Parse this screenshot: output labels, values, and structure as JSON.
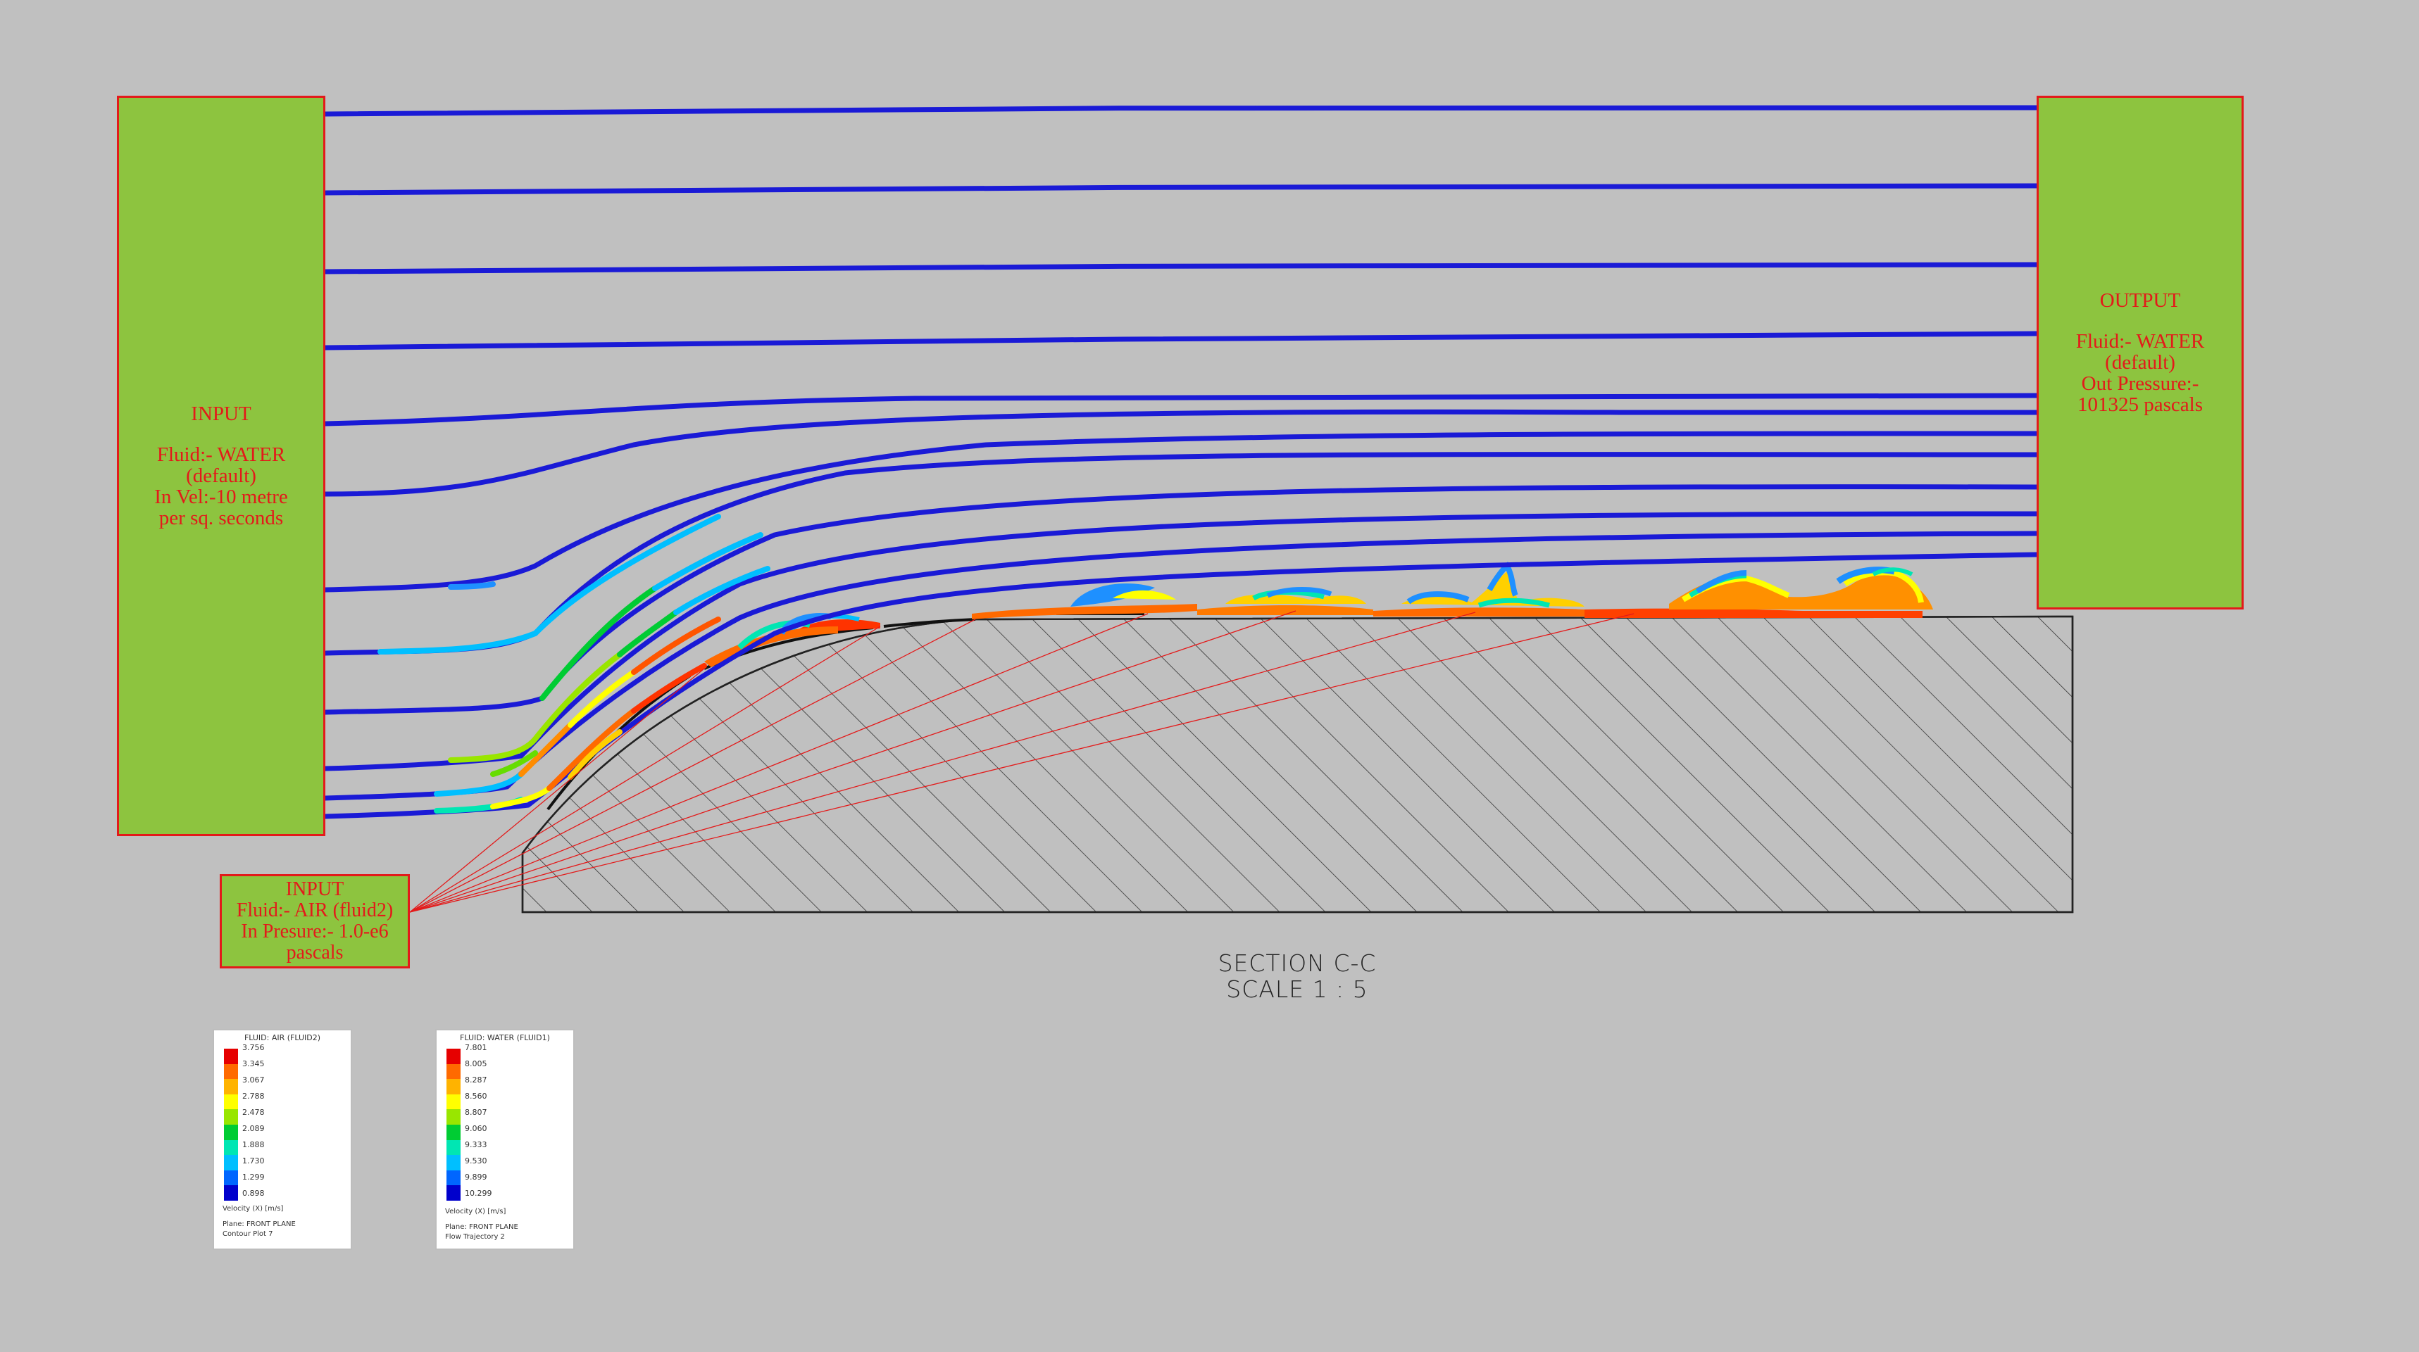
{
  "input_water": {
    "title": "INPUT",
    "lines": [
      "Fluid:- WATER",
      "(default)",
      "In Vel:-10 metre",
      "per sq. seconds"
    ]
  },
  "output": {
    "title": "OUTPUT",
    "lines": [
      "Fluid:- WATER",
      "(default)",
      "Out Pressure:-",
      "101325 pascals"
    ]
  },
  "input_air": {
    "title": "INPUT",
    "lines": [
      "Fluid:- AIR (fluid2)",
      "In Presure:- 1.0-e6",
      "pascals"
    ]
  },
  "section": {
    "line1": "SECTION C-C",
    "line2": "SCALE 1 : 5"
  },
  "legend_air": {
    "title": "FLUID: AIR (FLUID2)",
    "ticks": [
      "3.756",
      "3.345",
      "3.067",
      "2.788",
      "2.478",
      "2.089",
      "1.888",
      "1.730",
      "1.299",
      "0.898"
    ],
    "quantity": "Velocity (X) [m/s]",
    "plane": "Plane: FRONT PLANE",
    "plot": "Contour Plot 7"
  },
  "legend_water": {
    "title": "FLUID: WATER (FLUID1)",
    "ticks": [
      "7.801",
      "8.005",
      "8.287",
      "8.560",
      "8.807",
      "9.060",
      "9.333",
      "9.530",
      "9.899",
      "10.299"
    ],
    "quantity": "Velocity (X) [m/s]",
    "plane": "Plane: FRONT PLANE",
    "plot": "Flow Trajectory 2"
  },
  "colors": {
    "background": "#c0c0c0",
    "box_fill": "#8dc43f",
    "box_border": "#e31a1a",
    "streamline": "#1a1ad6",
    "scale": [
      "#e60000",
      "#ff6a00",
      "#ffb300",
      "#ffff00",
      "#99e600",
      "#00cc33",
      "#00e6b3",
      "#00bfff",
      "#0066ff",
      "#0000cc"
    ]
  }
}
